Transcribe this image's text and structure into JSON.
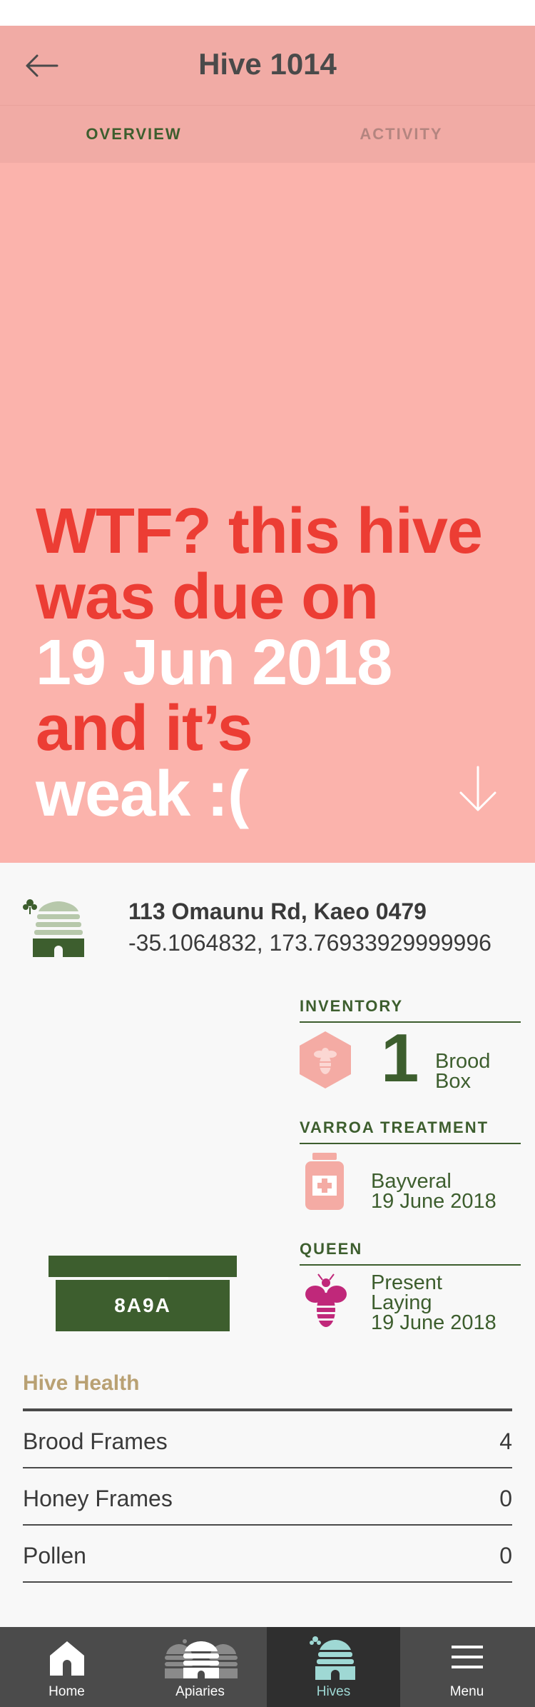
{
  "header": {
    "title": "Hive 1014"
  },
  "tabs": [
    {
      "label": "OVERVIEW"
    },
    {
      "label": "ACTIVITY"
    }
  ],
  "hero": {
    "line1": "WTF? this hive",
    "line2": "was due on",
    "line3": "19 Jun 2018",
    "line4": "and it’s",
    "line5": "weak :("
  },
  "location": {
    "address": "113 Omaunu Rd, Kaeo 0479",
    "coords": "-35.1064832, 173.76933929999996"
  },
  "inventory": {
    "title": "INVENTORY",
    "count": "1",
    "label_line1": "Brood",
    "label_line2": "Box"
  },
  "varroa": {
    "title": "VARROA TREATMENT",
    "product": "Bayveral",
    "date": "19 June 2018"
  },
  "queen": {
    "title": "QUEEN",
    "status": "Present",
    "state": "Laying",
    "date": "19 June 2018"
  },
  "hive_tag": "8A9A",
  "health": {
    "title": "Hive Health",
    "rows": [
      {
        "label": "Brood Frames",
        "value": "4"
      },
      {
        "label": "Honey Frames",
        "value": "0"
      },
      {
        "label": "Pollen",
        "value": "0"
      }
    ]
  },
  "nav": [
    {
      "label": "Home"
    },
    {
      "label": "Apiaries"
    },
    {
      "label": "Hives"
    },
    {
      "label": "Menu"
    }
  ],
  "colors": {
    "brand_green": "#3d5e2e",
    "hero_pink": "#fbb3ac",
    "header_pink": "#f1aba5",
    "alert_red": "#ec3d34",
    "accent_teal": "#9fd8d4",
    "health_gold": "#b9a173"
  }
}
